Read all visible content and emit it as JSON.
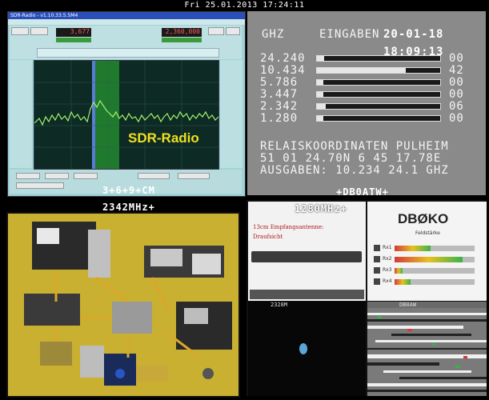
{
  "timestamp": "Fri 25.01.2013 17:24:11",
  "q1": {
    "window_title": "SDR-Radio - v1.10.33.5.5M4",
    "freq_readout": "3,677",
    "freq_readout2": "2,360,000",
    "overlay_label": "SDR-Radio",
    "caption": "3+6+9+CM"
  },
  "q2": {
    "header_unit": "GHZ",
    "header_label": "EINGABEN",
    "date": "20-01-18",
    "time": "18:09:13",
    "rows": [
      {
        "freq": "24.240",
        "level": 0.06,
        "value": "00"
      },
      {
        "freq": "10.434",
        "level": 0.72,
        "value": "42"
      },
      {
        "freq": "5.786",
        "level": 0.05,
        "value": "00"
      },
      {
        "freq": "3.447",
        "level": 0.05,
        "value": "00"
      },
      {
        "freq": "2.342",
        "level": 0.07,
        "value": "06"
      },
      {
        "freq": "1.280",
        "level": 0.05,
        "value": "00"
      }
    ],
    "line1": "RELAISKOORDINATEN PULHEIM",
    "line2": "51 01 24.70N  6 45 17.78E",
    "line3": "AUSGABEN: 10.234 24.1 GHZ",
    "caption": "+DB0ATW+"
  },
  "q3": {
    "caption": "2342MHz+"
  },
  "q4": {
    "caption": "1280MHz+",
    "antenna_title_1": "13cm Empfangsantenne:",
    "antenna_title_2": "Draufsicht",
    "callsign": "DBØKO",
    "panel_subtitle": "Feldstärke",
    "meter_labels": [
      "Rx1",
      "Rx2",
      "Rx3",
      "Rx4"
    ],
    "meter_levels": [
      0.45,
      0.85,
      0.1,
      0.2
    ],
    "sub_caption": "2328M",
    "sub_caption2": "DB0AW"
  },
  "colors": {
    "sdr_label": "#f0e020",
    "callsign": "#222222"
  }
}
